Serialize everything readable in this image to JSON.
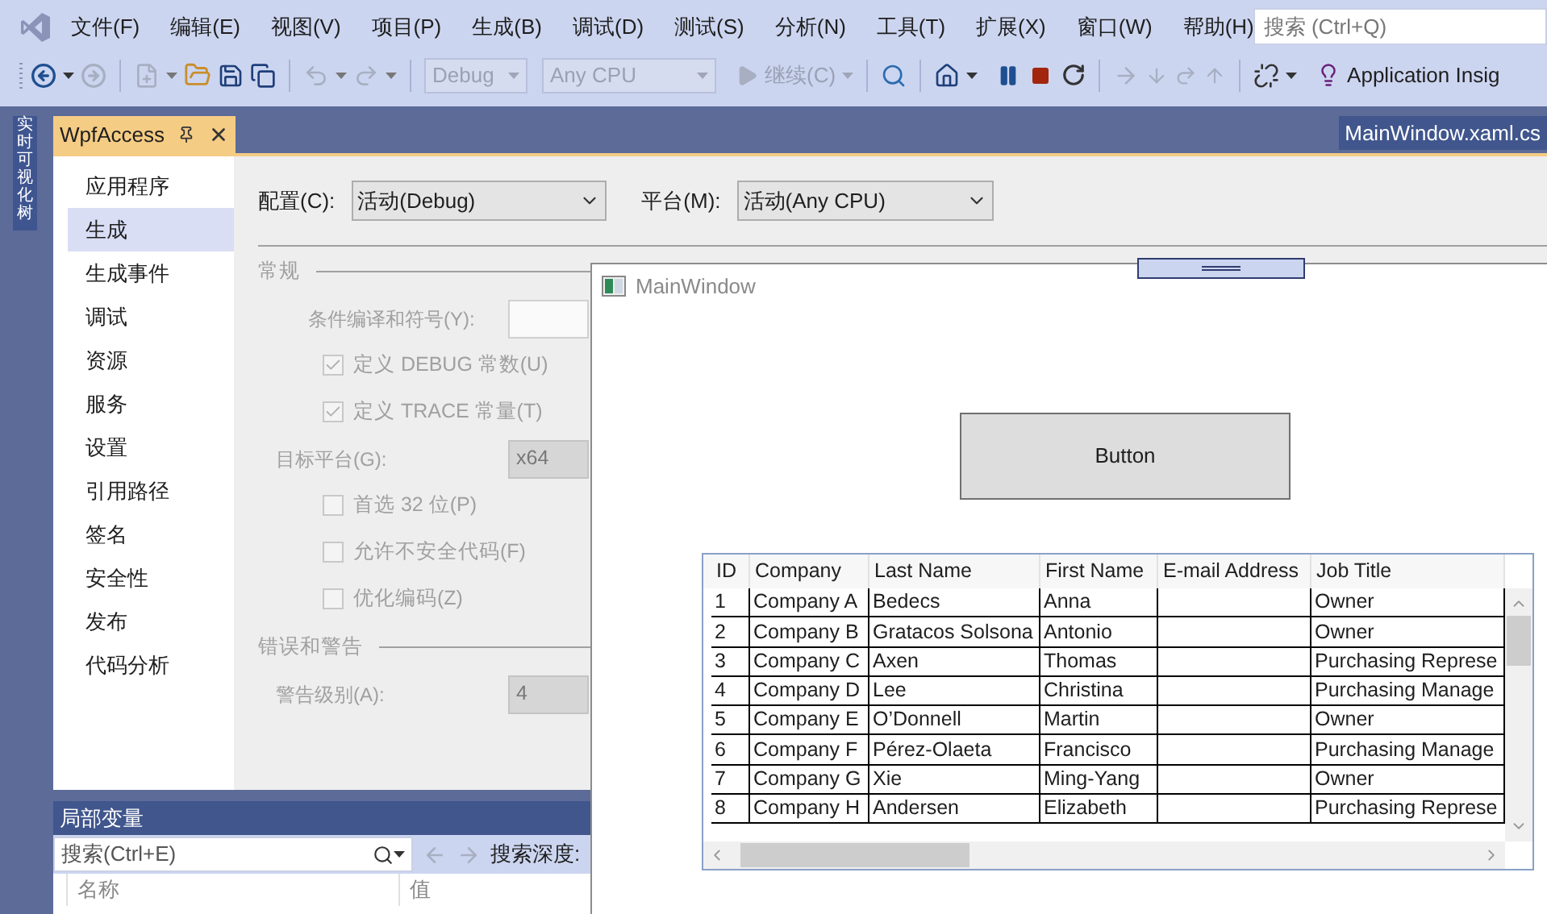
{
  "menu": [
    "文件(F)",
    "编辑(E)",
    "视图(V)",
    "项目(P)",
    "生成(B)",
    "调试(D)",
    "测试(S)",
    "分析(N)",
    "工具(T)",
    "扩展(X)",
    "窗口(W)",
    "帮助(H)"
  ],
  "search": {
    "placeholder": "搜索 (Ctrl+Q)"
  },
  "toolbar": {
    "configuration": "Debug",
    "platform": "Any CPU",
    "continue": "继续(C)",
    "insights": "Application Insig"
  },
  "side_tab": "实时可视化树",
  "doc_tabs": [
    {
      "title": "WpfAccess",
      "selected": true
    },
    {
      "title": "MainWindow.xaml.cs",
      "selected": false
    }
  ],
  "nav": [
    {
      "label": "应用程序",
      "selected": false
    },
    {
      "label": "生成",
      "selected": true
    },
    {
      "label": "生成事件",
      "selected": false
    },
    {
      "label": "调试",
      "selected": false
    },
    {
      "label": "资源",
      "selected": false
    },
    {
      "label": "服务",
      "selected": false
    },
    {
      "label": "设置",
      "selected": false
    },
    {
      "label": "引用路径",
      "selected": false
    },
    {
      "label": "签名",
      "selected": false
    },
    {
      "label": "安全性",
      "selected": false
    },
    {
      "label": "发布",
      "selected": false
    },
    {
      "label": "代码分析",
      "selected": false
    }
  ],
  "build": {
    "config_label": "配置(C):",
    "config_value": "活动(Debug)",
    "platform_label": "平台(M):",
    "platform_value": "活动(Any CPU)",
    "sections": [
      {
        "title": "常规",
        "rows": [
          {
            "kind": "field",
            "label": "条件编译和符号(Y):"
          },
          {
            "kind": "checkbox",
            "label": "定义 DEBUG 常数(U)",
            "checked": true
          },
          {
            "kind": "checkbox",
            "label": "定义 TRACE 常量(T)",
            "checked": true
          },
          {
            "kind": "select",
            "label": "目标平台(G):",
            "value": "x64"
          },
          {
            "kind": "checkbox",
            "label": "首选 32 位(P)",
            "checked": false
          },
          {
            "kind": "checkbox",
            "label": "允许不安全代码(F)",
            "checked": false
          },
          {
            "kind": "checkbox",
            "label": "优化编码(Z)",
            "checked": false
          }
        ]
      },
      {
        "title": "错误和警告",
        "rows": [
          {
            "kind": "select",
            "label": "警告级别(A):",
            "value": "4"
          }
        ]
      }
    ]
  },
  "main_window": {
    "title": "MainWindow",
    "button": "Button",
    "grid": {
      "columns": [
        "ID",
        "Company",
        "Last Name",
        "First Name",
        "E-mail Address",
        "Job Title"
      ],
      "rows": [
        [
          "1",
          "Company A",
          "Bedecs",
          "Anna",
          "",
          "Owner"
        ],
        [
          "2",
          "Company B",
          "Gratacos Solsona",
          "Antonio",
          "",
          "Owner"
        ],
        [
          "3",
          "Company C",
          "Axen",
          "Thomas",
          "",
          "Purchasing Represe"
        ],
        [
          "4",
          "Company D",
          "Lee",
          "Christina",
          "",
          "Purchasing Manage"
        ],
        [
          "5",
          "Company E",
          "O’Donnell",
          "Martin",
          "",
          "Owner"
        ],
        [
          "6",
          "Company F",
          "Pérez-Olaeta",
          "Francisco",
          "",
          "Purchasing Manage"
        ],
        [
          "7",
          "Company G",
          "Xie",
          "Ming-Yang",
          "",
          "Owner"
        ],
        [
          "8",
          "Company H",
          "Andersen",
          "Elizabeth",
          "",
          "Purchasing Represe"
        ]
      ]
    }
  },
  "locals": {
    "title": "局部变量",
    "search_placeholder": "搜索(Ctrl+E)",
    "depth_label": "搜索深度:",
    "columns": [
      "名称",
      "值"
    ]
  }
}
